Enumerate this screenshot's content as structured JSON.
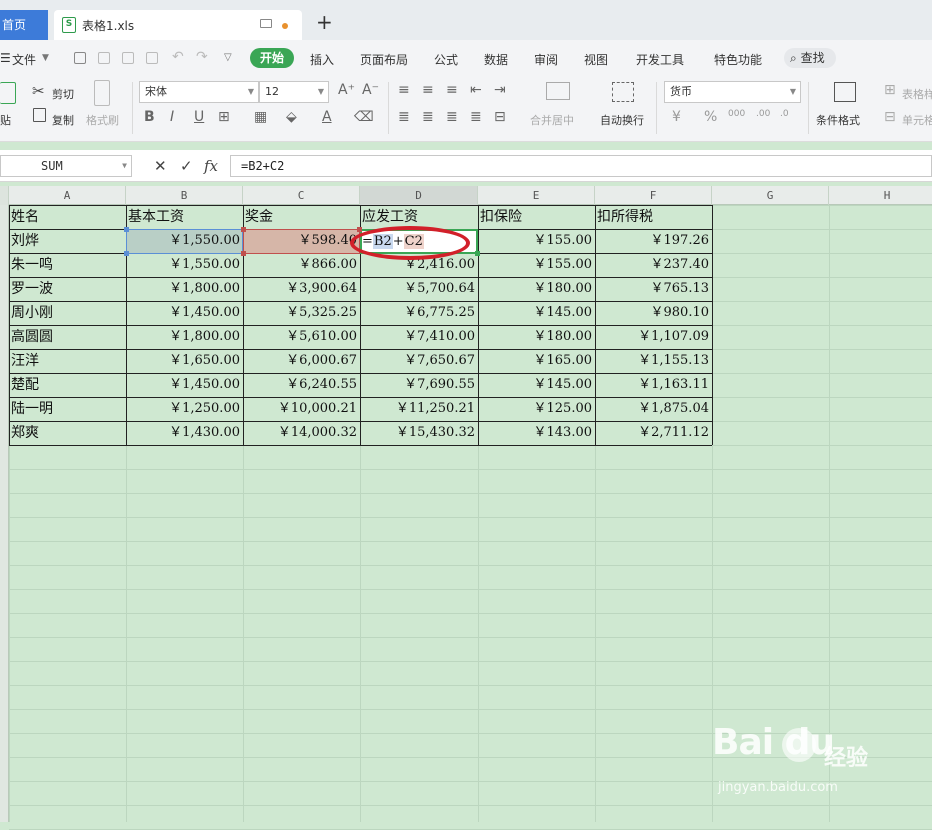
{
  "tabs": {
    "home_label": "首页",
    "file_label": "表格1.xls",
    "file_icon": "S"
  },
  "menu": {
    "file": "文件",
    "start": "开始",
    "insert": "插入",
    "layout": "页面布局",
    "formula": "公式",
    "data": "数据",
    "review": "审阅",
    "view": "视图",
    "devtools": "开发工具",
    "special": "特色功能",
    "search": "查找"
  },
  "ribbon": {
    "paste": "贴",
    "cut": "剪切",
    "copy": "复制",
    "format_painter": "格式刷",
    "font_name": "宋体",
    "font_size": "12",
    "merge_center": "合并居中",
    "wrap_text": "自动换行",
    "number_format": "货币",
    "cond_format": "条件格式",
    "table_style": "表格样",
    "cell_style": "单元格"
  },
  "formula_bar": {
    "name_box": "SUM",
    "formula": "=B2+C2",
    "fx": "fx"
  },
  "columns": [
    "A",
    "B",
    "C",
    "D",
    "E",
    "F",
    "G",
    "H"
  ],
  "headers": [
    "姓名",
    "基本工资",
    "奖金",
    "应发工资",
    "扣保险",
    "扣所得税"
  ],
  "rows": [
    {
      "name": "刘烨",
      "base": "￥1,550.00",
      "bonus": "￥598.40",
      "gross": "",
      "insurance": "￥155.00",
      "tax": "￥197.26"
    },
    {
      "name": "朱一鸣",
      "base": "￥1,550.00",
      "bonus": "￥866.00",
      "gross": "￥2,416.00",
      "insurance": "￥155.00",
      "tax": "￥237.40"
    },
    {
      "name": "罗一波",
      "base": "￥1,800.00",
      "bonus": "￥3,900.64",
      "gross": "￥5,700.64",
      "insurance": "￥180.00",
      "tax": "￥765.13"
    },
    {
      "name": "周小刚",
      "base": "￥1,450.00",
      "bonus": "￥5,325.25",
      "gross": "￥6,775.25",
      "insurance": "￥145.00",
      "tax": "￥980.10"
    },
    {
      "name": "高圆圆",
      "base": "￥1,800.00",
      "bonus": "￥5,610.00",
      "gross": "￥7,410.00",
      "insurance": "￥180.00",
      "tax": "￥1,107.09"
    },
    {
      "name": "汪洋",
      "base": "￥1,650.00",
      "bonus": "￥6,000.67",
      "gross": "￥7,650.67",
      "insurance": "￥165.00",
      "tax": "￥1,155.13"
    },
    {
      "name": "楚配",
      "base": "￥1,450.00",
      "bonus": "￥6,240.55",
      "gross": "￥7,690.55",
      "insurance": "￥145.00",
      "tax": "￥1,163.11"
    },
    {
      "name": "陆一明",
      "base": "￥1,250.00",
      "bonus": "￥10,000.21",
      "gross": "￥11,250.21",
      "insurance": "￥125.00",
      "tax": "￥1,875.04"
    },
    {
      "name": "郑爽",
      "base": "￥1,430.00",
      "bonus": "￥14,000.32",
      "gross": "￥15,430.32",
      "insurance": "￥143.00",
      "tax": "￥2,711.12"
    }
  ],
  "editing_cell": {
    "prefix": "=",
    "ref1": "B2",
    "op": "+",
    "ref2": "C2"
  },
  "watermark": {
    "logo": "Bai  du",
    "cn": "经验",
    "url": "jingyan.baidu.com"
  },
  "colors": {
    "accent": "#3aa655",
    "grid_bg": "#cfe8d1",
    "ref_b": "#5b8fd6",
    "ref_c": "#c0504d",
    "annotation": "#d2202a"
  }
}
